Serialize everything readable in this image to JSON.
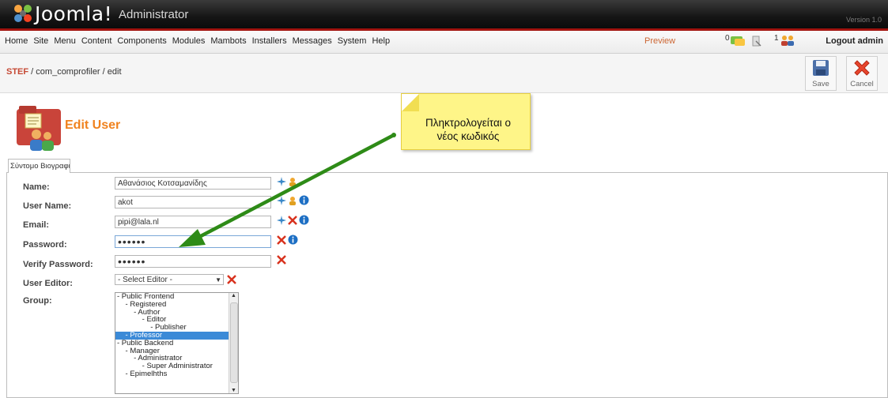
{
  "header": {
    "logo_text": "Joomla!",
    "logo_sub": "Administrator",
    "version": "Version 1.0"
  },
  "menubar": {
    "items": [
      "Home",
      "Site",
      "Menu",
      "Content",
      "Components",
      "Modules",
      "Mambots",
      "Installers",
      "Messages",
      "System",
      "Help"
    ],
    "preview": "Preview",
    "messages_count": "0",
    "users_count": "1",
    "logout": "Logout admin"
  },
  "toolbar": {
    "breadcrumb_home": "STEF",
    "breadcrumb_rest": " / com_comprofiler / edit",
    "save_label": "Save",
    "cancel_label": "Cancel"
  },
  "page": {
    "title": "Edit User"
  },
  "tab": {
    "label": "Σύντομο Βιογραφικό"
  },
  "form": {
    "name_label": "Name:",
    "name_value": "Αθανάσιος Κοτσαμανίδης",
    "username_label": "User Name:",
    "username_value": "akot",
    "email_label": "Email:",
    "email_value": "pipi@lala.nl",
    "password_label": "Password:",
    "password_value": "••••••",
    "verify_label": "Verify Password:",
    "verify_value": "••••••",
    "editor_label": "User Editor:",
    "editor_value": "- Select Editor -",
    "group_label": "Group:",
    "groups": [
      {
        "text": "- Public Frontend",
        "selected": false
      },
      {
        "text": "    - Registered",
        "selected": false
      },
      {
        "text": "        - Author",
        "selected": false
      },
      {
        "text": "            - Editor",
        "selected": false
      },
      {
        "text": "                - Publisher",
        "selected": false
      },
      {
        "text": "    - Professor",
        "selected": true
      },
      {
        "text": "- Public Backend",
        "selected": false
      },
      {
        "text": "    - Manager",
        "selected": false
      },
      {
        "text": "        - Administrator",
        "selected": false
      },
      {
        "text": "            - Super Administrator",
        "selected": false
      },
      {
        "text": "    - Epimelhths",
        "selected": false
      }
    ]
  },
  "callout": {
    "text_line1": "Πληκτρολογείται ο",
    "text_line2": "νέος κωδικός"
  },
  "colors": {
    "accent_orange": "#f0821e",
    "arrow_green": "#2e8b17",
    "header_red": "#a1140f",
    "selection_blue": "#3b8ad7"
  }
}
